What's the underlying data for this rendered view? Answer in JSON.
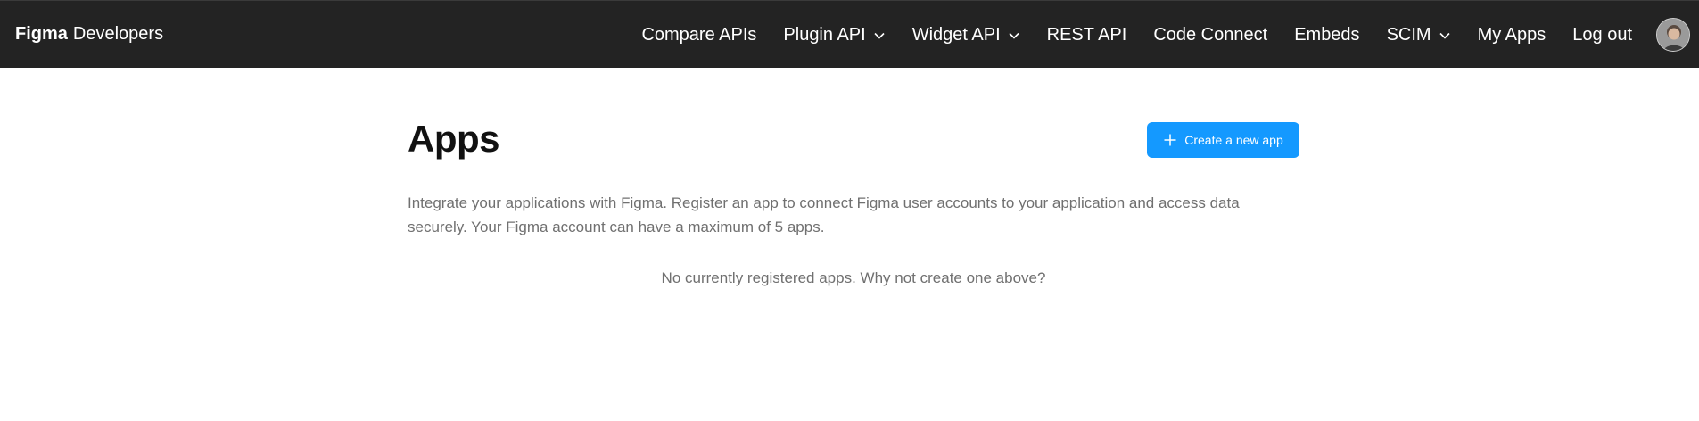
{
  "header": {
    "brand_strong": "Figma",
    "brand_light": "Developers",
    "nav": [
      {
        "label": "Compare APIs",
        "has_dropdown": false
      },
      {
        "label": "Plugin API",
        "has_dropdown": true
      },
      {
        "label": "Widget API",
        "has_dropdown": true
      },
      {
        "label": "REST API",
        "has_dropdown": false
      },
      {
        "label": "Code Connect",
        "has_dropdown": false
      },
      {
        "label": "Embeds",
        "has_dropdown": false
      },
      {
        "label": "SCIM",
        "has_dropdown": true
      },
      {
        "label": "My Apps",
        "has_dropdown": false
      },
      {
        "label": "Log out",
        "has_dropdown": false
      }
    ],
    "avatar_icon": "user-avatar"
  },
  "main": {
    "title": "Apps",
    "create_button_label": "Create a new app",
    "create_button_icon": "plus-icon",
    "description": "Integrate your applications with Figma. Register an app to connect Figma user accounts to your application and access data securely. Your Figma account can have a maximum of 5 apps.",
    "empty_message": "No currently registered apps. Why not create one above?"
  },
  "colors": {
    "topbar": "#232323",
    "accent": "#1499ff",
    "muted_text": "#707070",
    "title_text": "#111111"
  }
}
